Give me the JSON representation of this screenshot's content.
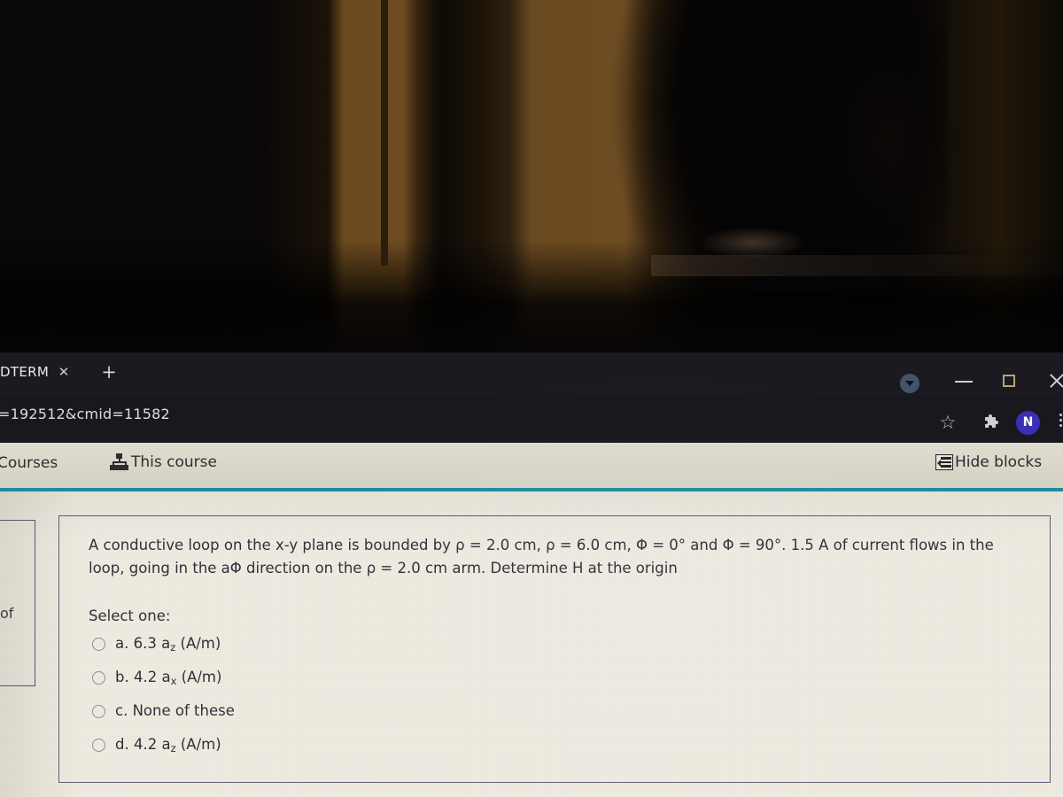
{
  "browser": {
    "tab": {
      "title": "DTERM",
      "close_icon": "close-icon",
      "new_tab_icon": "plus-icon"
    },
    "url": "=192512&cmid=11582",
    "toolbar": {
      "bookmark_icon": "★",
      "extensions_icon": "puzzle-piece-icon",
      "profile_initial": "N",
      "menu_icon": "kebab-menu-icon"
    },
    "window_controls": {
      "restore_label": "▼",
      "minimize_label": "—",
      "maximize_label": "❐",
      "close_label": "✕"
    },
    "colors": {
      "chrome_bg": "#17161b",
      "tabstrip_bg": "#1b1a20",
      "profile_avatar": "#3b2fb8"
    }
  },
  "moodle_nav": {
    "courses_label": "Courses",
    "this_course_label": "This course",
    "this_course_icon": "sitemap-icon",
    "hide_blocks_label": "Hide blocks",
    "hide_blocks_icon": "panel-collapse-icon",
    "divider_color": "#1d8c9e",
    "bar_bg": "#dcd9cc"
  },
  "left_block": {
    "visible_text": "of"
  },
  "question": {
    "text": "A conductive loop on the x-y plane is bounded by ρ = 2.0 cm, ρ = 6.0 cm, Φ = 0° and Φ = 90°. 1.5 A of current flows in the loop, going in the aΦ direction on the ρ = 2.0 cm arm. Determine H at the origin",
    "select_one_label": "Select one:",
    "options": [
      {
        "key": "a.",
        "value": "6.3 a",
        "sub": "z",
        "unit": " (A/m)",
        "selected": false
      },
      {
        "key": "b.",
        "value": "4.2 a",
        "sub": "x",
        "unit": " (A/m)",
        "selected": false
      },
      {
        "key": "c.",
        "value": "None of these",
        "sub": "",
        "unit": "",
        "selected": false
      },
      {
        "key": "d.",
        "value": "4.2 a",
        "sub": "z",
        "unit": " (A/m)",
        "selected": false
      }
    ],
    "panel_border_color": "#5d5d78",
    "page_bg": "#efece2"
  }
}
